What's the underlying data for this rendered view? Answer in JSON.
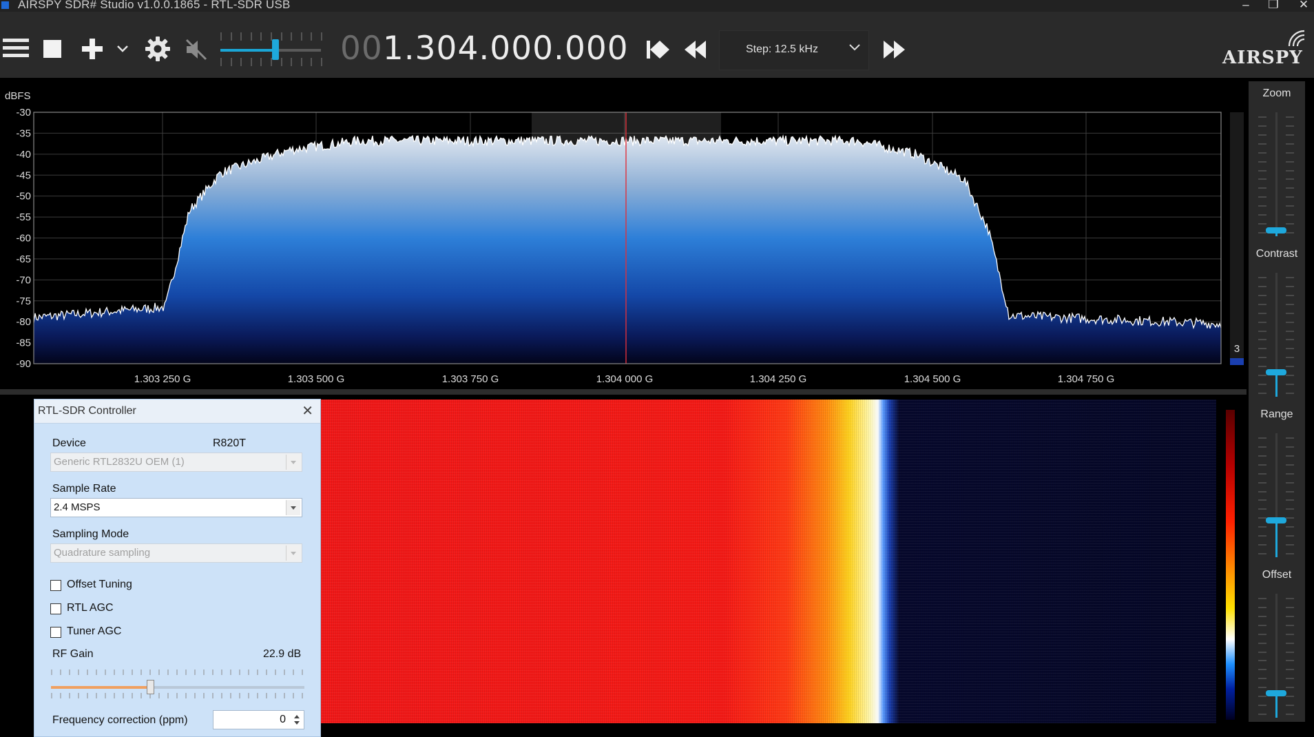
{
  "window": {
    "title": "AIRSPY SDR# Studio v1.0.0.1865 - RTL-SDR USB",
    "controls": [
      "–",
      "❐",
      "✕"
    ]
  },
  "toolbar": {
    "icons": [
      "hamburger-menu-icon",
      "stop-icon",
      "plus-icon",
      "chevron-down-icon",
      "gear-icon",
      "mute-icon"
    ],
    "volume_level": 0.55,
    "frequency_dim": "00",
    "frequency_bright": "1.304.000.000",
    "step_label": "Step: 12.5 kHz",
    "logo": "AIRSPY"
  },
  "spectrum": {
    "ylabel": "dBFS",
    "yticks": [
      "-30",
      "-35",
      "-40",
      "-45",
      "-50",
      "-55",
      "-60",
      "-65",
      "-70",
      "-75",
      "-80",
      "-85",
      "-90"
    ],
    "xticks": [
      "1.303 250 G",
      "1.303 500 G",
      "1.303 750 G",
      "1.304 000 G",
      "1.304 250 G",
      "1.304 500 G",
      "1.304 750 G"
    ],
    "right_level_number": "3"
  },
  "side_panel": {
    "zoom_label": "Zoom",
    "contrast_label": "Contrast",
    "range_label": "Range",
    "offset_label": "Offset",
    "zoom_value": 0.05,
    "contrast_value": 0.2,
    "range_value": 0.3,
    "offset_value": 0.2
  },
  "rtl_controller": {
    "title": "RTL-SDR Controller",
    "close": "✕",
    "device_label": "Device",
    "tuner": "R820T",
    "device_value": "Generic RTL2832U OEM (1)",
    "sample_rate_label": "Sample Rate",
    "sample_rate_value": "2.4 MSPS",
    "sampling_mode_label": "Sampling Mode",
    "sampling_mode_value": "Quadrature sampling",
    "offset_tuning": "Offset Tuning",
    "rtl_agc": "RTL AGC",
    "tuner_agc": "Tuner AGC",
    "rf_gain_label": "RF Gain",
    "rf_gain_value": "22.9 dB",
    "rf_gain_level": 0.39,
    "freq_correction_label": "Frequency correction (ppm)",
    "freq_correction_value": "0"
  }
}
